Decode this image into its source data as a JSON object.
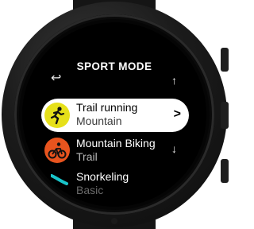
{
  "header": {
    "title": "SPORT MODE"
  },
  "nav": {
    "back_icon": "back-arrow-icon",
    "up_icon": "arrow-up-icon",
    "down_icon": "arrow-down-icon",
    "back_glyph": "↩",
    "up_glyph": "↑",
    "down_glyph": "↓"
  },
  "sports": [
    {
      "name": "Trail running",
      "sub": "Mountain",
      "icon": "trail-running-icon",
      "badge_color": "#e6e01a",
      "selected": true,
      "chevron": ">"
    },
    {
      "name": "Mountain Biking",
      "sub": "Trail",
      "icon": "mountain-biking-icon",
      "badge_color": "#e8541e",
      "selected": false
    },
    {
      "name": "Snorkeling",
      "sub": "Basic",
      "icon": "swimming-icon",
      "badge_color": "#19c4c9",
      "selected": false
    }
  ],
  "colors": {
    "selected_row_bg": "#ffffff",
    "screen_bg": "#000000"
  }
}
